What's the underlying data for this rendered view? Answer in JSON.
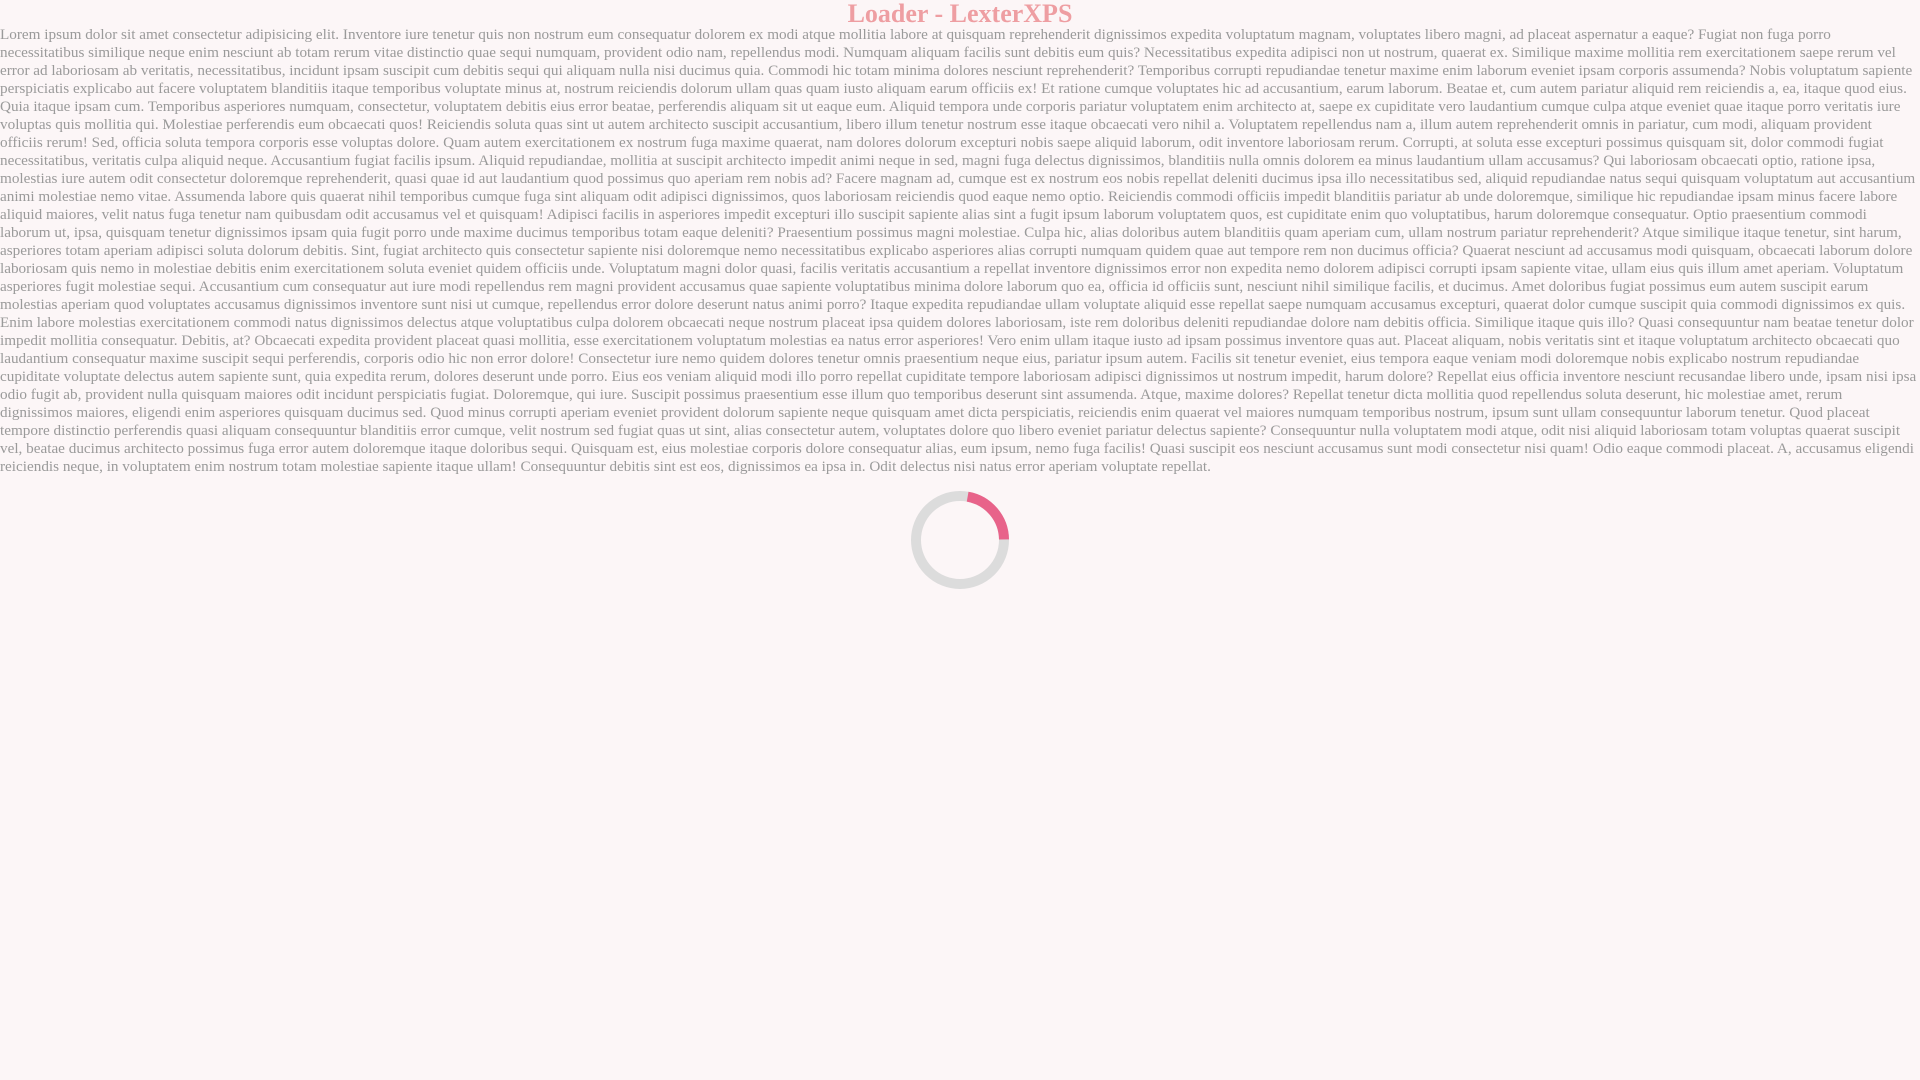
{
  "page": {
    "title": "Loader - LexterXPS",
    "body_text": "Lorem ipsum dolor sit amet consectetur adipisicing elit. Inventore iure tenetur quis non nostrum eum consequatur dolorem ex modi atque mollitia labore at quisquam reprehenderit dignissimos expedita voluptatum magnam, voluptates libero magni, ad placeat aspernatur a eaque? Fugiat non fuga porro necessitatibus similique neque enim nesciunt ab totam rerum vitae distinctio quae sequi numquam, provident odio nam, repellendus modi. Numquam aliquam facilis sunt debitis eum quis? Necessitatibus expedita adipisci non ut nostrum, quaerat ex. Similique maxime mollitia rem exercitationem saepe rerum vel error ad laboriosam ab veritatis, necessitatibus, incidunt ipsam suscipit cum debitis sequi qui aliquam nulla nisi ducimus quia. Commodi hic totam minima dolores nesciunt reprehenderit? Temporibus corrupti repudiandae tenetur maxime enim laborum eveniet ipsam corporis assumenda? Nobis voluptatum sapiente perspiciatis explicabo aut facere voluptatem blanditiis itaque temporibus voluptate minus at, nostrum reiciendis dolorum ullam quas quam iusto aliquam earum officiis ex! Et ratione cumque voluptates hic ad accusantium, earum laborum. Beatae et, cum autem pariatur aliquid rem reiciendis a, ea, itaque quod eius. Quia itaque ipsam cum. Temporibus asperiores numquam, consectetur, voluptatem debitis eius error beatae, perferendis aliquam sit ut eaque eum. Aliquid tempora unde corporis pariatur voluptatem enim architecto at, saepe ex cupiditate vero laudantium cumque culpa atque eveniet quae itaque porro veritatis iure voluptas quis mollitia qui. Molestiae perferendis eum obcaecati quos! Reiciendis soluta quas sint ut autem architecto suscipit accusantium, libero illum tenetur nostrum esse itaque obcaecati vero nihil a. Voluptatem repellendus nam a, illum autem reprehenderit omnis in pariatur, cum modi, aliquam provident officiis rerum! Sed, officia soluta tempora corporis esse voluptas dolore. Quam autem exercitationem ex nostrum fuga maxime quaerat, nam dolores dolorum excepturi nobis saepe aliquid laborum, odit inventore laboriosam rerum. Corrupti, at soluta esse excepturi possimus quisquam sit, dolor commodi fugiat necessitatibus, veritatis culpa aliquid neque. Accusantium fugiat facilis ipsum. Aliquid repudiandae, mollitia at suscipit architecto impedit animi neque in sed, magni fuga delectus dignissimos, blanditiis nulla omnis dolorem ea minus laudantium ullam accusamus? Qui laboriosam obcaecati optio, ratione ipsa, molestias iure autem odit consectetur doloremque reprehenderit, quasi quae id aut laudantium quod possimus quo aperiam rem nobis ad? Facere magnam ad, cumque est ex nostrum eos nobis repellat deleniti ducimus ipsa illo necessitatibus sed, aliquid repudiandae natus sequi quisquam voluptatum aut accusantium animi molestiae nemo vitae. Assumenda labore quis quaerat nihil temporibus cumque fuga sint aliquam odit adipisci dignissimos, quos laboriosam reiciendis quod eaque nemo optio. Reiciendis commodi officiis impedit blanditiis pariatur ab unde doloremque, similique hic repudiandae ipsam minus facere labore aliquid maiores, velit natus fuga tenetur nam quibusdam odit accusamus vel et quisquam! Adipisci facilis in asperiores impedit excepturi illo suscipit sapiente alias sint a fugit ipsum laborum voluptatem quos, est cupiditate enim quo voluptatibus, harum doloremque consequatur. Optio praesentium commodi laborum ut, ipsa, quisquam tenetur dignissimos ipsam quia fugit porro unde maxime ducimus temporibus totam eaque deleniti? Praesentium possimus magni molestiae. Culpa hic, alias doloribus autem blanditiis quam aperiam cum, ullam nostrum pariatur reprehenderit? Atque similique itaque tenetur, sint harum, asperiores totam aperiam adipisci soluta dolorum debitis. Sint, fugiat architecto quis consectetur sapiente nisi doloremque nemo necessitatibus explicabo asperiores alias corrupti numquam quidem quae aut tempore rem non ducimus officia? Quaerat nesciunt ad accusamus modi quisquam, obcaecati laborum dolore laboriosam quis nemo in molestiae debitis enim exercitationem soluta eveniet quidem officiis unde. Voluptatum magni dolor quasi, facilis veritatis accusantium a repellat inventore dignissimos error non expedita nemo dolorem adipisci corrupti ipsam sapiente vitae, ullam eius quis illum amet aperiam. Voluptatum asperiores fugit molestiae sequi. Accusantium cum consequatur aut iure modi repellendus rem magni provident accusamus quae sapiente voluptatibus minima dolore laborum quo ea, officia id officiis sunt, nesciunt nihil similique facilis, et ducimus. Amet doloribus fugiat possimus eum autem suscipit earum molestias aperiam quod voluptates accusamus dignissimos inventore sunt nisi ut cumque, repellendus error dolore deserunt natus animi porro? Itaque expedita repudiandae ullam voluptate aliquid esse repellat saepe numquam accusamus excepturi, quaerat dolor cumque suscipit quia commodi dignissimos ex quis. Enim labore molestias exercitationem commodi natus dignissimos delectus atque voluptatibus culpa dolorem obcaecati neque nostrum placeat ipsa quidem dolores laboriosam, iste rem doloribus deleniti repudiandae dolore nam debitis officia. Similique itaque quis illo? Quasi consequuntur nam beatae tenetur dolor impedit mollitia consequatur. Debitis, at? Obcaecati expedita provident placeat quasi mollitia, esse exercitationem voluptatum molestias ea natus error asperiores! Vero enim ullam itaque iusto ad ipsam possimus inventore quas aut. Placeat aliquam, nobis veritatis sint et itaque voluptatum architecto obcaecati quo laudantium consequatur maxime suscipit sequi perferendis, corporis odio hic non error dolore! Consectetur iure nemo quidem dolores tenetur omnis praesentium neque eius, pariatur ipsum autem. Facilis sit tenetur eveniet, eius tempora eaque veniam modi doloremque nobis explicabo nostrum repudiandae cupiditate voluptate delectus autem sapiente sunt, quia expedita rerum, dolores deserunt unde porro. Eius eos veniam aliquid modi illo porro repellat cupiditate tempore laboriosam adipisci dignissimos ut nostrum impedit, harum dolore? Repellat eius officia inventore nesciunt recusandae libero unde, ipsam nisi ipsa odio fugit ab, provident nulla quisquam maiores odit incidunt perspiciatis fugiat. Doloremque, qui iure. Suscipit possimus praesentium esse illum quo temporibus deserunt sint assumenda. Atque, maxime dolores? Repellat tenetur dicta mollitia quod repellendus soluta deserunt, hic molestiae amet, rerum dignissimos maiores, eligendi enim asperiores quisquam ducimus sed. Quod minus corrupti aperiam eveniet provident dolorum sapiente neque quisquam amet dicta perspiciatis, reiciendis enim quaerat vel maiores numquam temporibus nostrum, ipsum sunt ullam consequuntur laborum tenetur. Quod placeat tempore distinctio perferendis quasi aliquam consequuntur blanditiis error cumque, velit nostrum sed fugiat quas ut sint, alias consectetur autem, voluptates dolore quo libero eveniet pariatur delectus sapiente? Consequuntur nulla voluptatem modi atque, odit nisi aliquid laboriosam totam voluptas quaerat suscipit vel, beatae ducimus architecto possimus fuga error autem doloremque itaque doloribus sequi. Quisquam est, eius molestiae corporis dolore consequatur alias, eum ipsum, nemo fuga facilis! Quasi suscipit eos nesciunt accusamus sunt modi consectetur nisi quam! Odio eaque commodi placeat. A, accusamus eligendi reiciendis neque, in voluptatem enim nostrum totam molestiae sapiente itaque ullam! Consequuntur debitis sint est eos, dignissimos ea ipsa in. Odit delectus nisi natus error aperiam voluptate repellat."
  },
  "loader": {
    "icon": "spinner-icon",
    "track_color": "#dcdcdc",
    "arc_color": "#e8638a",
    "arc_fraction": 0.22
  },
  "colors": {
    "background": "#fcf6f7",
    "title": "#ee9a9e",
    "text": "#9a9a9a"
  }
}
